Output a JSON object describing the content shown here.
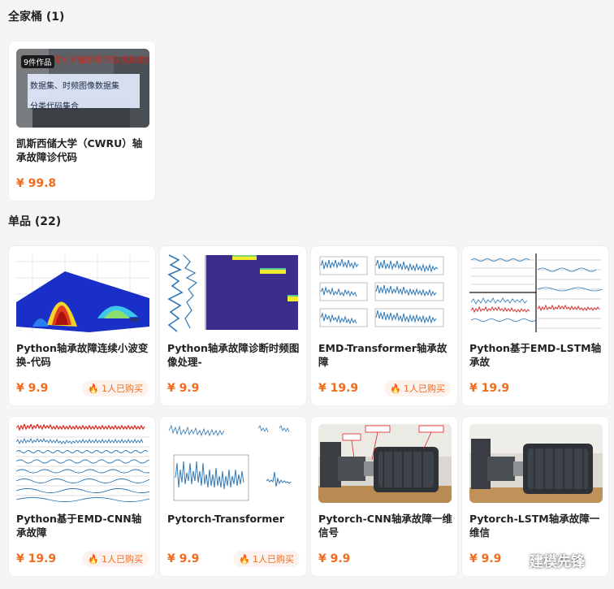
{
  "bundle_section": {
    "title": "全家桶 (1)"
  },
  "bundle_card": {
    "badge": "9件作品",
    "overlay_red_text": "凯斯西储大学轴承故障数据集使用教程",
    "overlay_lines": [
      "数据集、时频图像数据集",
      "分类代码集合"
    ],
    "title": "凯斯西储大学（CWRU）轴承故障诊代码",
    "price": "¥ 99.8"
  },
  "single_section": {
    "title": "单品 (22)"
  },
  "products": [
    {
      "title": "Python轴承故障连续小波变换-代码",
      "price": "¥ 9.9",
      "buyers": "1人已购买",
      "thumb": "wavelet-3d-surface"
    },
    {
      "title": "Python轴承故障诊断时频图像处理-",
      "price": "¥ 9.9",
      "buyers": "",
      "thumb": "time-frequency-spectrogram"
    },
    {
      "title": "EMD-Transformer轴承故障",
      "price": "¥ 19.9",
      "buyers": "1人已购买",
      "thumb": "emd-imf-grid"
    },
    {
      "title": "Python基于EMD-LSTM轴承故",
      "price": "¥ 19.9",
      "buyers": "",
      "thumb": "emd-multi-panel"
    },
    {
      "title": "Python基于EMD-CNN轴承故障",
      "price": "¥ 19.9",
      "buyers": "1人已购买",
      "thumb": "emd-stacked-signals"
    },
    {
      "title": "Pytorch-Transformer",
      "price": "¥ 9.9",
      "buyers": "1人已购买",
      "thumb": "vibration-signals"
    },
    {
      "title": "Pytorch-CNN轴承故障一维信号",
      "price": "¥ 9.9",
      "buyers": "",
      "thumb": "motor-test-rig-labeled"
    },
    {
      "title": "Pytorch-LSTM轴承故障一维信",
      "price": "¥ 9.9",
      "buyers": "",
      "thumb": "motor-test-rig"
    }
  ],
  "watermark": {
    "text": "建模先锋",
    "icon": "wechat-icon"
  },
  "colors": {
    "price": "#f26b1d",
    "buyers_bg": "#fdf3ee",
    "page_bg": "#f5f5f6"
  }
}
